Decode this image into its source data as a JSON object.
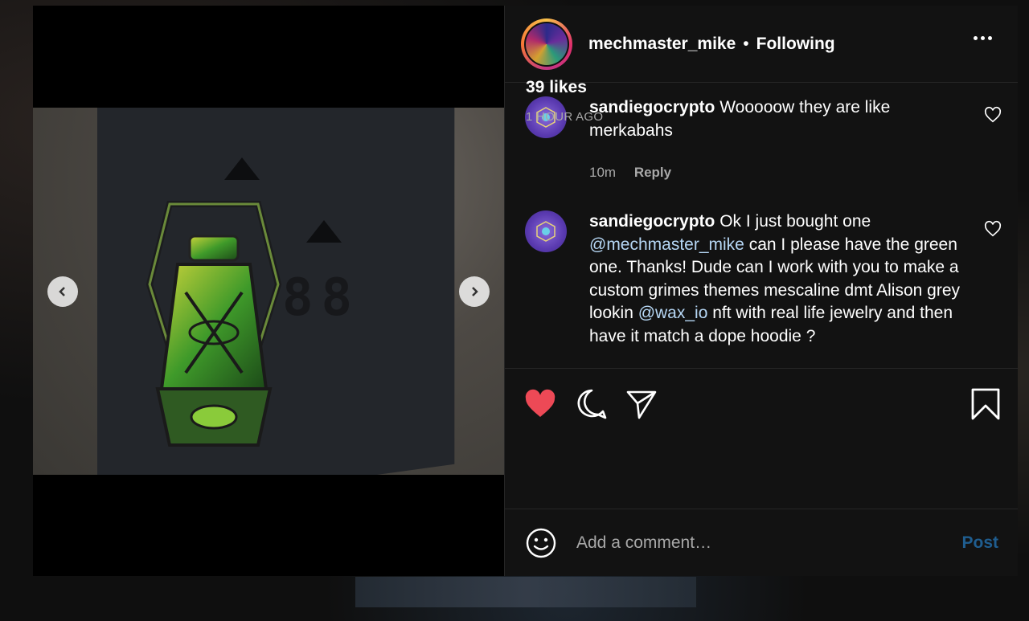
{
  "post": {
    "username": "mechmaster_mike",
    "separator": "•",
    "follow_status": "Following",
    "image_alt": "Lantern enamel pin on dark card"
  },
  "comments": [
    {
      "username": "sandiegocrypto",
      "text": "Wooooow they are like merkabahs",
      "time": "10m",
      "reply_label": "Reply"
    },
    {
      "username": "sandiegocrypto",
      "text_parts": [
        "Ok I just bought one ",
        "@mechmaster_mike",
        " can I please have the green one. Thanks! Dude can I work with you to make a custom grimes themes mescaline dmt Alison grey lookin ",
        "@wax_io",
        " nft with real life jewelry and then have it match a dope hoodie ?"
      ]
    }
  ],
  "engagement": {
    "likes": "39 likes",
    "posted": "1 HOUR AGO",
    "liked": true
  },
  "composer": {
    "placeholder": "Add a comment…",
    "post_label": "Post"
  },
  "icons": {
    "like": "heart-filled-icon",
    "comment": "comment-bubble-icon",
    "share": "paper-plane-icon",
    "save": "bookmark-icon",
    "emoji": "smiley-icon",
    "more": "more-horizontal-icon",
    "prev": "chevron-left-icon",
    "next": "chevron-right-icon"
  },
  "colors": {
    "like_red": "#ED4956",
    "mention_blue": "#B6D7F5",
    "post_blue_disabled": "#1F5D8F",
    "panel_bg": "#121212"
  }
}
